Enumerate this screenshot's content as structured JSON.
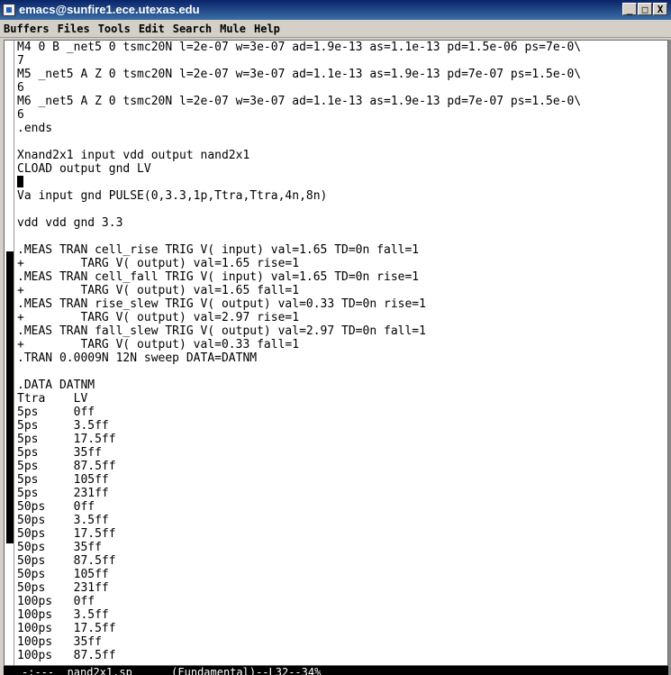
{
  "window": {
    "title": "emacs@sunfire1.ece.utexas.edu",
    "buttons": [
      "_",
      "□",
      "X"
    ]
  },
  "menubar": {
    "items": [
      "Buffers",
      "Files",
      "Tools",
      "Edit",
      "Search",
      "Mule",
      "Help"
    ]
  },
  "editor": {
    "lines": [
      "M4 0 B _net5 0 tsmc20N l=2e-07 w=3e-07 ad=1.9e-13 as=1.1e-13 pd=1.5e-06 ps=7e-0\\",
      "7",
      "M5 _net5 A Z 0 tsmc20N l=2e-07 w=3e-07 ad=1.1e-13 as=1.9e-13 pd=7e-07 ps=1.5e-0\\",
      "6",
      "M6 _net5 A Z 0 tsmc20N l=2e-07 w=3e-07 ad=1.1e-13 as=1.9e-13 pd=7e-07 ps=1.5e-0\\",
      "6",
      ".ends",
      "",
      "Xnand2x1 input vdd output nand2x1",
      "CLOAD output gnd LV",
      "",
      "Va input gnd PULSE(0,3.3,1p,Ttra,Ttra,4n,8n)",
      "",
      "vdd vdd gnd 3.3",
      "",
      ".MEAS TRAN cell_rise TRIG V( input) val=1.65 TD=0n fall=1",
      "+        TARG V( output) val=1.65 rise=1",
      ".MEAS TRAN cell_fall TRIG V( input) val=1.65 TD=0n rise=1",
      "+        TARG V( output) val=1.65 fall=1",
      ".MEAS TRAN rise_slew TRIG V( output) val=0.33 TD=0n rise=1",
      "+        TARG V( output) val=2.97 rise=1",
      ".MEAS TRAN fall_slew TRIG V( output) val=2.97 TD=0n fall=1",
      "+        TARG V( output) val=0.33 fall=1",
      ".TRAN 0.0009N 12N sweep DATA=DATNM",
      "",
      ".DATA DATNM",
      "Ttra    LV",
      "5ps     0ff",
      "5ps     3.5ff",
      "5ps     17.5ff",
      "5ps     35ff",
      "5ps     87.5ff",
      "5ps     105ff",
      "5ps     231ff",
      "50ps    0ff",
      "50ps    3.5ff",
      "50ps    17.5ff",
      "50ps    35ff",
      "50ps    87.5ff",
      "50ps    105ff",
      "50ps    231ff",
      "100ps   0ff",
      "100ps   3.5ff",
      "100ps   17.5ff",
      "100ps   35ff",
      "100ps   87.5ff"
    ],
    "cursor_line": 10
  },
  "modeline": {
    "text": "-:---  nand2x1.sp      (Fundamental)--L32--34%"
  }
}
